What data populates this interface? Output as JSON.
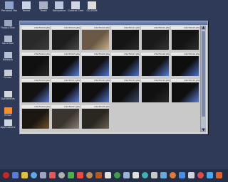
{
  "desktop": {
    "top_icons": [
      {
        "label": "Personal Home",
        "icon": "folder-icon",
        "color": "#8fa3c9"
      },
      {
        "label": "Home",
        "icon": "home-icon",
        "color": "#c9d2e6"
      },
      {
        "label": "Trash",
        "icon": "trash-icon",
        "color": "#a8b2c4"
      },
      {
        "label": "Konqueror",
        "icon": "browser-icon",
        "color": "#b8c6e0"
      },
      {
        "label": "Control Center",
        "icon": "settings-icon",
        "color": "#d0d6e2"
      },
      {
        "label": "CD-ROM",
        "icon": "cdrom-icon",
        "color": "#dcdcdc"
      }
    ],
    "left_icons": [
      {
        "label": "Floppy Disk",
        "icon": "floppy-icon",
        "color": "#9aa6bd"
      },
      {
        "label": "Hard Disk",
        "icon": "disk-icon",
        "color": "#aeb8cc"
      },
      {
        "label": "Network",
        "icon": "network-icon",
        "color": "#b7c1d4"
      },
      {
        "label": "Printer",
        "icon": "printer-icon",
        "color": "#c6ccd6"
      },
      {
        "label": "Documents",
        "icon": "document-icon",
        "color": "#d2d6de"
      },
      {
        "label": "Email",
        "icon": "mail-icon",
        "color": "#ff8c2a"
      },
      {
        "label": "Applications",
        "icon": "app-icon",
        "color": "#cfd5e0"
      }
    ]
  },
  "window": {
    "thumbnails": [
      {
        "name": "DSCF0018.JPG",
        "tone": "#2a2a2a",
        "accent": "#3c3c3c"
      },
      {
        "name": "DSCF0019.JPG",
        "tone": "#1e1e1e",
        "accent": "#4a4a4a"
      },
      {
        "name": "DSCF0020.JPG",
        "tone": "#6a5a45",
        "accent": "#c9b08a"
      },
      {
        "name": "DSCF0021.JPG",
        "tone": "#151515",
        "accent": "#2a2a2a"
      },
      {
        "name": "DSCF0022.JPG",
        "tone": "#1a1a1a",
        "accent": "#353535"
      },
      {
        "name": "DSCF0023.JPG",
        "tone": "#141414",
        "accent": "#2e2e2e"
      },
      {
        "name": "DSCF0024.JPG",
        "tone": "#101010",
        "accent": "#2a2a2a"
      },
      {
        "name": "DSCF0025.JPG",
        "tone": "#0e0e0e",
        "accent": "#5a7ed8"
      },
      {
        "name": "DSCF0026.JPG",
        "tone": "#121212",
        "accent": "#4f75d4"
      },
      {
        "name": "DSCF0027.JPG",
        "tone": "#0f0f0f",
        "accent": "#4f73cc"
      },
      {
        "name": "DSCF0028.JPG",
        "tone": "#111111",
        "accent": "#5a7ed8"
      },
      {
        "name": "DSCF0029.JPG",
        "tone": "#0e0e0e",
        "accent": "#4d70c9"
      },
      {
        "name": "DSCF0030.JPG",
        "tone": "#121212",
        "accent": "#5678d0"
      },
      {
        "name": "DSCF0031.JPG",
        "tone": "#0d0d0d",
        "accent": "#5a7ed8"
      },
      {
        "name": "DSCF0032.JPG",
        "tone": "#101010",
        "accent": "#4f73cc"
      },
      {
        "name": "DSCF0033.JPG",
        "tone": "#0f0f0f",
        "accent": "#3a4a6a"
      },
      {
        "name": "DSCF0034.JPG",
        "tone": "#111111",
        "accent": "#2a2a2a"
      },
      {
        "name": "DSCF0035.JPG",
        "tone": "#0f0f0f",
        "accent": "#5a7ed8"
      },
      {
        "name": "DSCF0036.JPG",
        "tone": "#1c1710",
        "accent": "#6b5533"
      },
      {
        "name": "DSCF0037.JPG",
        "tone": "#3b3530",
        "accent": "#8a8078"
      },
      {
        "name": "DSCF0038.JPG",
        "tone": "#2a2620",
        "accent": "#6b6258"
      }
    ]
  },
  "taskbar": {
    "icons": [
      {
        "name": "kmenu-icon",
        "color": "#c62828"
      },
      {
        "name": "terminal-icon",
        "color": "#5b7bd6"
      },
      {
        "name": "star-icon",
        "color": "#e0c040"
      },
      {
        "name": "home-icon",
        "color": "#5fa8e8"
      },
      {
        "name": "folder-icon",
        "color": "#9aa6bd"
      },
      {
        "name": "calendar-icon",
        "color": "#e05a5a"
      },
      {
        "name": "tool-icon",
        "color": "#b0b0b0"
      },
      {
        "name": "paint-icon",
        "color": "#4caf50"
      },
      {
        "name": "settings-icon",
        "color": "#e34a4a"
      },
      {
        "name": "photo-icon",
        "color": "#c08b5a"
      },
      {
        "name": "person-icon",
        "color": "#b05a2a"
      },
      {
        "name": "game-icon",
        "color": "#e0e0e0"
      },
      {
        "name": "chart-icon",
        "color": "#3f9c4b"
      },
      {
        "name": "monitor-icon",
        "color": "#9ab2d6"
      },
      {
        "name": "media-icon",
        "color": "#e0e0e0"
      },
      {
        "name": "screen-icon",
        "color": "#3ab0b0"
      },
      {
        "name": "disk-icon",
        "color": "#c8c8c8"
      },
      {
        "name": "ball-icon",
        "color": "#6aa9e0"
      },
      {
        "name": "doc-icon",
        "color": "#e07a3a"
      },
      {
        "name": "globe-icon",
        "color": "#4a90e2"
      },
      {
        "name": "tv-icon",
        "color": "#cfd5e0"
      },
      {
        "name": "shield-icon",
        "color": "#e04a4a"
      },
      {
        "name": "clock-icon",
        "color": "#4aa8e8"
      },
      {
        "name": "power-icon",
        "color": "#e06030"
      }
    ]
  }
}
